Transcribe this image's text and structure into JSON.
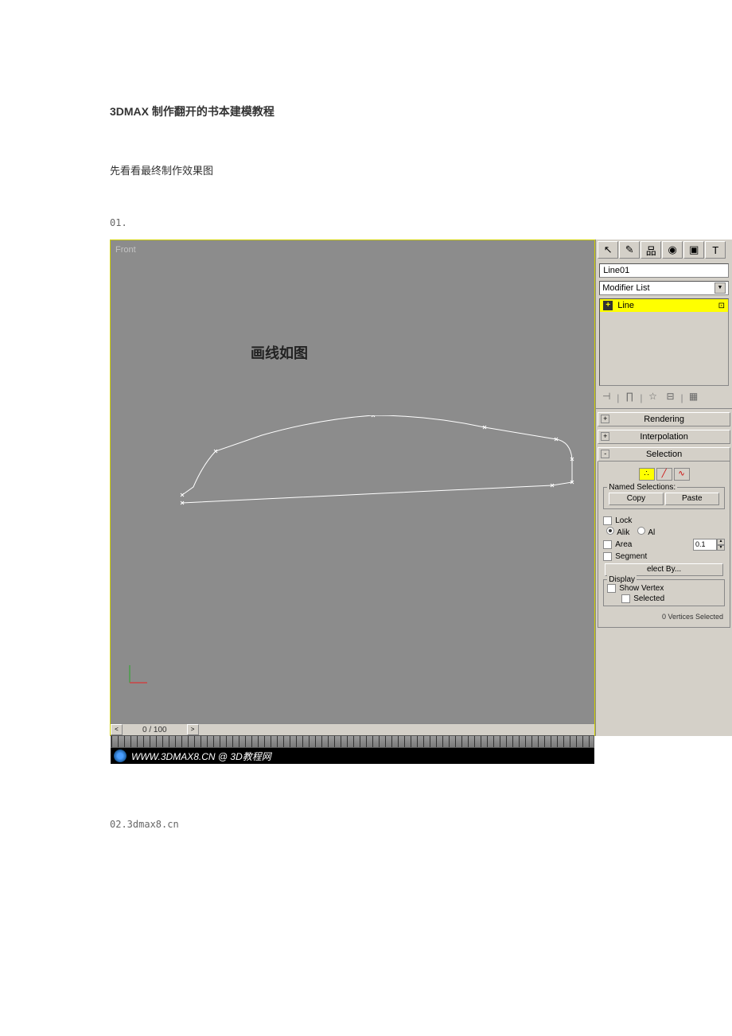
{
  "document": {
    "title": "3DMAX 制作翻开的书本建模教程",
    "subtitle": "先看看最终制作效果图",
    "step1": "01.",
    "step2": "02.3dmax8.cn"
  },
  "viewport": {
    "label": "Front",
    "caption": "画线如图",
    "timeline_frame": "0 / 100"
  },
  "footer": {
    "watermark": "WWW.3DMAX8.CN @ 3D教程网"
  },
  "panel": {
    "object_name": "Line01",
    "modifier_list_label": "Modifier List",
    "stack_item": "Line",
    "rollouts": {
      "rendering": "Rendering",
      "interpolation": "Interpolation",
      "selection": "Selection"
    },
    "selection": {
      "named_sel_label": "Named Selections:",
      "copy_btn": "Copy",
      "paste_btn": "Paste",
      "lock_label": "Lock",
      "alik_label": "Alik",
      "al_label": "Al",
      "area_label": "Area",
      "area_value": "0.1",
      "segment_label": "Segment",
      "select_by_btn": "elect By..."
    },
    "display": {
      "title": "Display",
      "show_vertex": "Show Vertex",
      "selected": "Selected"
    },
    "status": "0 Vertices Selected"
  }
}
